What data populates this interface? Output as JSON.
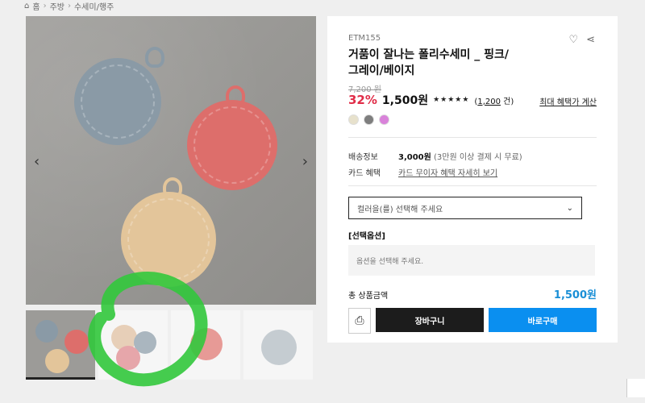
{
  "breadcrumb": {
    "home_icon": "home-icon",
    "home": "홈",
    "items": [
      "주방",
      "수세미/행주"
    ]
  },
  "gallery": {
    "prev_icon": "chevron-left-icon",
    "next_icon": "chevron-right-icon",
    "thumbnails": 4,
    "annotation_color": "#32c83c"
  },
  "product": {
    "code": "ETM155",
    "title": "거품이 잘나는 폴리수세미 _ 핑크/ 그레이/베이지",
    "wish_icon": "heart-icon",
    "share_icon": "share-icon",
    "original_price": "7,200 원",
    "discount": "32%",
    "price": "1,500원",
    "stars": "★★★★★",
    "reviews_open": "(",
    "reviews_count": "1,200",
    "reviews_close": " 건)",
    "max_benefit": "최대 혜택가 계산",
    "swatches": [
      "#e7e1cc",
      "#7e7e7e",
      "#d982da"
    ]
  },
  "shipping": {
    "label": "배송정보",
    "value": "3,000원",
    "note": "(3만원 이상 결제 시 무료)"
  },
  "card": {
    "label": "카드 혜택",
    "link": "카드 무이자 혜택 자세히 보기"
  },
  "options": {
    "select_placeholder": "컬러을(를) 선택해 주세요",
    "heading": "[선택옵션]",
    "empty_text": "옵션을 선택해 주세요."
  },
  "total": {
    "label": "총 상품금액",
    "value": "1,500원"
  },
  "buttons": {
    "gift_icon": "gift-icon",
    "cart": "장바구니",
    "buy": "바로구매"
  },
  "colors": {
    "discount": "#e02d48",
    "total": "#1a8fd6",
    "buy_button": "#0a8ff0",
    "cart_button": "#1c1c1c"
  }
}
